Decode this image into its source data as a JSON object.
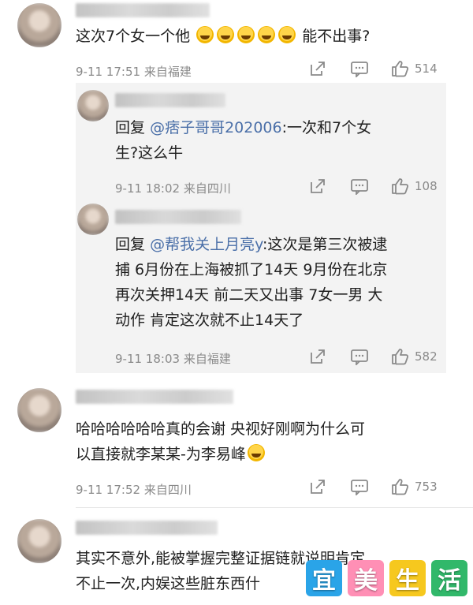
{
  "comments": [
    {
      "text_before": "这次7个女一个他",
      "text_after": "能不出事?",
      "emoji_count": 5,
      "time": "9-11 17:51",
      "location": "来自福建",
      "like_count": "514"
    },
    {
      "reply_prefix": "回复",
      "reply_user": "@痞子哥哥202006",
      "text": ":一次和7个女生?这么牛",
      "line1_tail": ":一次和7个女",
      "line2": "生?这么牛",
      "time": "9-11 18:02",
      "location": "来自四川",
      "like_count": "108"
    },
    {
      "reply_prefix": "回复",
      "reply_user": "@帮我关上月亮y",
      "line1_tail": ":这次是第三次被逮",
      "line2": "捕 6月份在上海被抓了14天 9月份在北京",
      "line3": "再次关押14天 前二天又出事 7女一男 大",
      "line4": "动作 肯定这次就不止14天了",
      "time": "9-11 18:03",
      "location": "来自福建",
      "like_count": "582"
    },
    {
      "line1": "哈哈哈哈哈哈真的会谢 央视好刚啊为什么可",
      "line2": "以直接就李某某-为李易峰",
      "time": "9-11 17:52",
      "location": "来自四川",
      "like_count": "753"
    },
    {
      "line1": "其实不意外,能被掌握完整证据链就说明肯定",
      "line2": "不止一次,内娱这些脏东西什"
    }
  ],
  "watermark": [
    "宜",
    "美",
    "生",
    "活"
  ],
  "colors": {
    "link": "#4a6fa8",
    "meta": "#8a8a8a"
  }
}
